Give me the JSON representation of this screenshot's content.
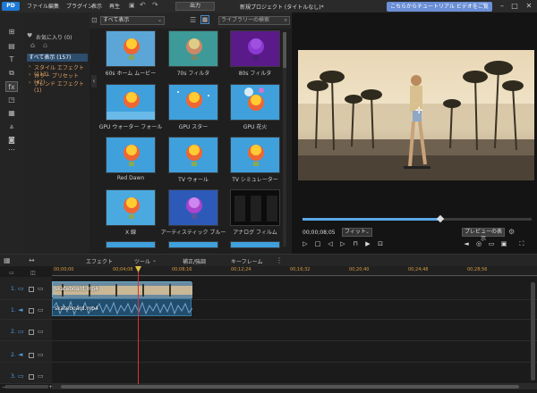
{
  "titlebar": {
    "logo": "PD",
    "menus": [
      "ファイル",
      "編集",
      "プラグイン",
      "表示",
      "再生"
    ],
    "output_label": "出力",
    "project_title": "新規プロジェクト (タイトルなし)*",
    "tutorial_label": "こちらからチュートリアル ビデオをご覧いただけます。"
  },
  "categories": {
    "favorites": "お気に入り (0)",
    "all": "すべて表示 (157)",
    "items": [
      "スタイル エフェクト (113)",
      "カラー プリセット (42)",
      "ブレンド エフェクト (1)"
    ]
  },
  "library": {
    "filter": "すべて表示",
    "search_placeholder": "ライブラリーの検索",
    "items": [
      {
        "label": "60s ホーム ムービー"
      },
      {
        "label": "70s フィルタ"
      },
      {
        "label": "80s フィルタ"
      },
      {
        "label": "GPU ウォーター フォール"
      },
      {
        "label": "GPU スター"
      },
      {
        "label": "GPU 花火"
      },
      {
        "label": "Red Dawn"
      },
      {
        "label": "TV ウォール"
      },
      {
        "label": "TV シミュレーター"
      },
      {
        "label": "X 線"
      },
      {
        "label": "アーティスティック ブルー"
      },
      {
        "label": "アナログ フィルム"
      }
    ]
  },
  "preview": {
    "timecode": "00;00;08;05",
    "fit": "フィット",
    "quality_button": "プレビューの表示",
    "progress_fraction": 0.6
  },
  "timeline_toolbar": [
    "エフェクト",
    "ツール",
    "補正/強調",
    "キーフレーム"
  ],
  "ruler": [
    "00;00;00",
    "00;04;08",
    "00;08;16",
    "00;12;24",
    "00;16;32",
    "00;20;40",
    "00;24;48",
    "00;28;56"
  ],
  "tracks": [
    "1.",
    "1.",
    "2.",
    "2.",
    "3."
  ],
  "clips": {
    "video": "skateboard.mp4",
    "audio": "skateboard.mp4"
  }
}
